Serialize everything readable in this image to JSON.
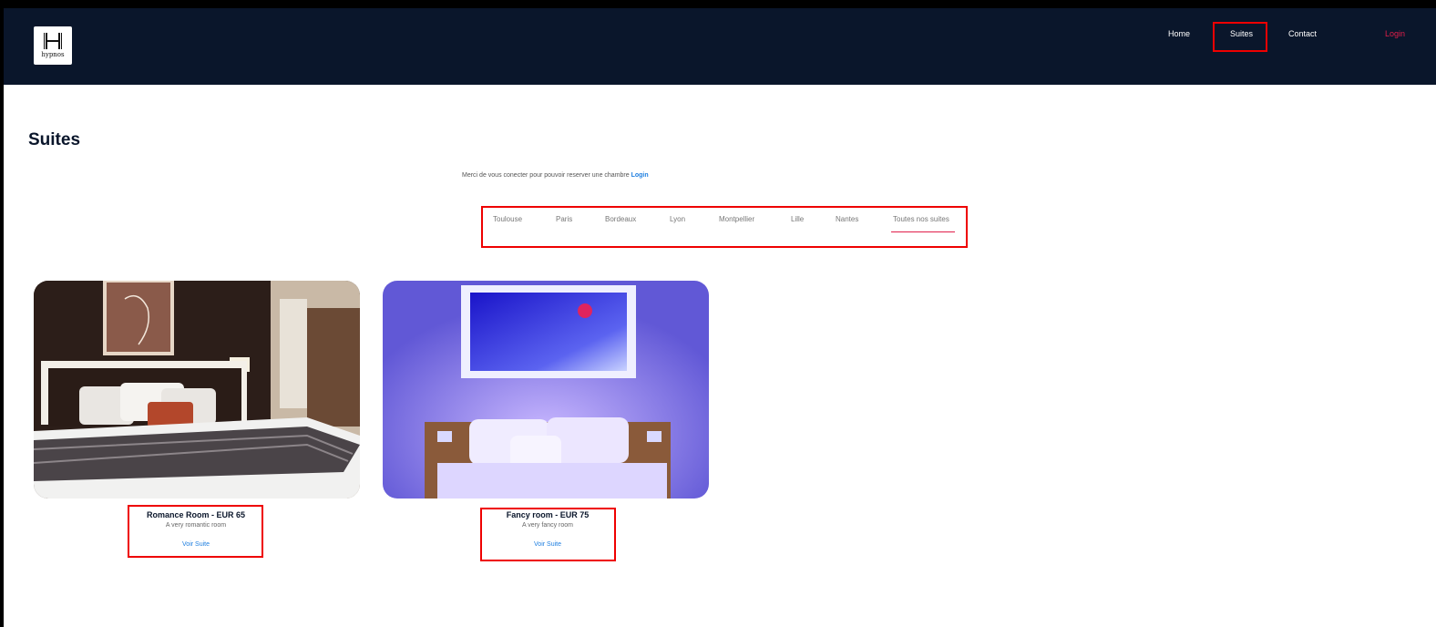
{
  "nav": {
    "logo_text": "hypnos",
    "links": [
      {
        "label": "Home"
      },
      {
        "label": "Suites"
      },
      {
        "label": "Contact"
      },
      {
        "label": "Login"
      }
    ]
  },
  "page_title": "Suites",
  "notice": {
    "text": "Merci de vous conecter pour pouvoir reserver une chambre",
    "link": "Login"
  },
  "city_tabs": [
    "Toulouse",
    "Paris",
    "Bordeaux",
    "Lyon",
    "Montpellier",
    "Lille",
    "Nantes",
    "Toutes nos suites"
  ],
  "active_tab": "Toutes nos suites",
  "rooms": [
    {
      "title": "Romance Room - EUR 65",
      "description": "A very romantic room",
      "link": "Voir Suite"
    },
    {
      "title": "Fancy room - EUR 75",
      "description": "A very fancy room",
      "link": "Voir Suite"
    }
  ],
  "colors": {
    "navbar": "#0a162b",
    "accent": "#e01e4a",
    "link": "#1f7fe0",
    "highlight_box": "#ee0000"
  }
}
